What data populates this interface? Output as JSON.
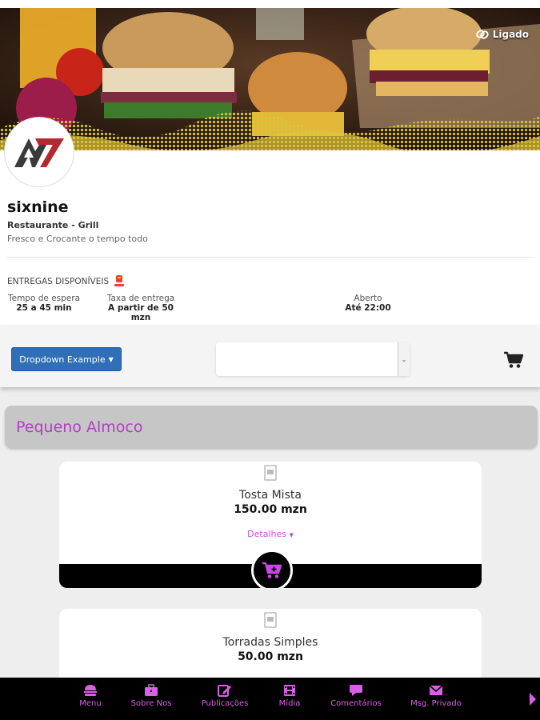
{
  "header": {
    "status_label": "Ligado"
  },
  "restaurant": {
    "name": "sixnine",
    "category": "Restaurante - Grill",
    "tagline": "Fresco e Crocante o tempo todo",
    "deliveries_label": "ENTREGAS DISPONÍVEIS",
    "info": [
      {
        "label": "Tempo de espera",
        "value": "25 a 45 min"
      },
      {
        "label": "Taxa de entrega",
        "value": "A partir de 50 mzn"
      },
      {
        "label": "Aberto",
        "value": "Até 22:00"
      }
    ]
  },
  "toolbar": {
    "dropdown_label": "Dropdown Example",
    "select_value": ""
  },
  "section": {
    "title": "Pequeno Almoco"
  },
  "products": [
    {
      "name": "Tosta Mista",
      "price": "150.00 mzn",
      "details_label": "Detalhes"
    },
    {
      "name": "Torradas Simples",
      "price": "50.00 mzn"
    }
  ],
  "bottom_nav": {
    "items": [
      {
        "label": "Menu",
        "icon": "menu-icon"
      },
      {
        "label": "Sobre Nos",
        "icon": "briefcase-icon"
      },
      {
        "label": "Publicações",
        "icon": "edit-icon"
      },
      {
        "label": "Mídia",
        "icon": "film-icon"
      },
      {
        "label": "Comentários",
        "icon": "comment-icon"
      },
      {
        "label": "Msg. Privado",
        "icon": "envelope-icon"
      }
    ]
  },
  "colors": {
    "accent": "#c04fd6",
    "primary_button": "#2f6fb7",
    "section_bg": "#c6c6c6"
  }
}
